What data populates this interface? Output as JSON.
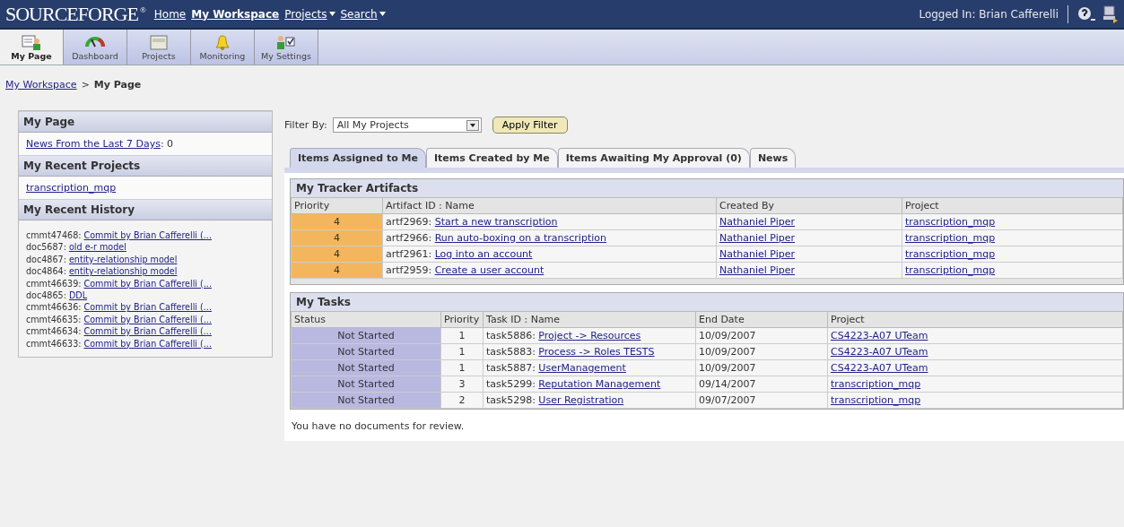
{
  "topbar": {
    "logo": "SOURCEFORGE",
    "logo_mark": "®",
    "links": [
      {
        "label": "Home",
        "kind": "link",
        "selected": false
      },
      {
        "label": "My Workspace",
        "kind": "link",
        "selected": true
      },
      {
        "label": "Projects",
        "kind": "menu",
        "selected": false
      },
      {
        "label": "Search",
        "kind": "menu",
        "selected": false
      }
    ],
    "logged_in": "Logged In: Brian Cafferelli"
  },
  "toolbar": [
    {
      "label": "My Page",
      "selected": true
    },
    {
      "label": "Dashboard",
      "selected": false
    },
    {
      "label": "Projects",
      "selected": false
    },
    {
      "label": "Monitoring",
      "selected": false
    },
    {
      "label": "My Settings",
      "selected": false
    }
  ],
  "breadcrumb": {
    "link": "My Workspace",
    "separator": ">",
    "current": "My Page"
  },
  "sidebar": {
    "my_page": {
      "title": "My Page",
      "news_link": "News From the Last 7 Days",
      "news_count": ": 0"
    },
    "recent_projects": {
      "title": "My Recent Projects",
      "items": [
        "transcription_mqp"
      ]
    },
    "recent_history": {
      "title": "My Recent History",
      "items": [
        {
          "id": "cmmt47468:",
          "link": "Commit by Brian Cafferelli (..."
        },
        {
          "id": "doc5687:",
          "link": "old e-r model"
        },
        {
          "id": "doc4867:",
          "link": "entity-relationship model"
        },
        {
          "id": "doc4864:",
          "link": "entity-relationship model"
        },
        {
          "id": "cmmt46639:",
          "link": "Commit by Brian Cafferelli (..."
        },
        {
          "id": "doc4865:",
          "link": "DDL"
        },
        {
          "id": "cmmt46636:",
          "link": "Commit by Brian Cafferelli (..."
        },
        {
          "id": "cmmt46635:",
          "link": "Commit by Brian Cafferelli (..."
        },
        {
          "id": "cmmt46634:",
          "link": "Commit by Brian Cafferelli (..."
        },
        {
          "id": "cmmt46633:",
          "link": "Commit by Brian Cafferelli (..."
        }
      ]
    }
  },
  "filter": {
    "label": "Filter By:",
    "value": "All My Projects",
    "button": "Apply Filter"
  },
  "tabs": [
    {
      "label": "Items Assigned to Me",
      "selected": true
    },
    {
      "label": "Items Created by Me",
      "selected": false
    },
    {
      "label": "Items Awaiting My Approval (0)",
      "selected": false
    },
    {
      "label": "News",
      "selected": false
    }
  ],
  "artifacts": {
    "title": "My Tracker Artifacts",
    "columns": [
      "Priority",
      "Artifact ID : Name",
      "Created By",
      "Project"
    ],
    "rows": [
      {
        "priority": "4",
        "id": "artf2969:",
        "name": "Start a new transcription",
        "created_by": "Nathaniel Piper",
        "project": "transcription_mqp"
      },
      {
        "priority": "4",
        "id": "artf2966:",
        "name": "Run auto-boxing on a transcription",
        "created_by": "Nathaniel Piper",
        "project": "transcription_mqp"
      },
      {
        "priority": "4",
        "id": "artf2961:",
        "name": "Log into an account",
        "created_by": "Nathaniel Piper",
        "project": "transcription_mqp"
      },
      {
        "priority": "4",
        "id": "artf2959:",
        "name": "Create a user account",
        "created_by": "Nathaniel Piper",
        "project": "transcription_mqp"
      }
    ]
  },
  "tasks": {
    "title": "My Tasks",
    "columns": [
      "Status",
      "Priority",
      "Task ID : Name",
      "End Date",
      "Project"
    ],
    "rows": [
      {
        "status": "Not Started",
        "priority": "1",
        "id": "task5886:",
        "name": "Project -> Resources",
        "end_date": "10/09/2007",
        "project": "CS4223-A07 UTeam"
      },
      {
        "status": "Not Started",
        "priority": "1",
        "id": "task5883:",
        "name": "Process -> Roles TESTS",
        "end_date": "10/09/2007",
        "project": "CS4223-A07 UTeam"
      },
      {
        "status": "Not Started",
        "priority": "1",
        "id": "task5887:",
        "name": "UserManagement",
        "end_date": "10/09/2007",
        "project": "CS4223-A07 UTeam"
      },
      {
        "status": "Not Started",
        "priority": "3",
        "id": "task5299:",
        "name": "Reputation Management",
        "end_date": "09/14/2007",
        "project": "transcription_mqp"
      },
      {
        "status": "Not Started",
        "priority": "2",
        "id": "task5298:",
        "name": "User Registration",
        "end_date": "09/07/2007",
        "project": "transcription_mqp"
      }
    ]
  },
  "documents_note": "You have no documents for review."
}
